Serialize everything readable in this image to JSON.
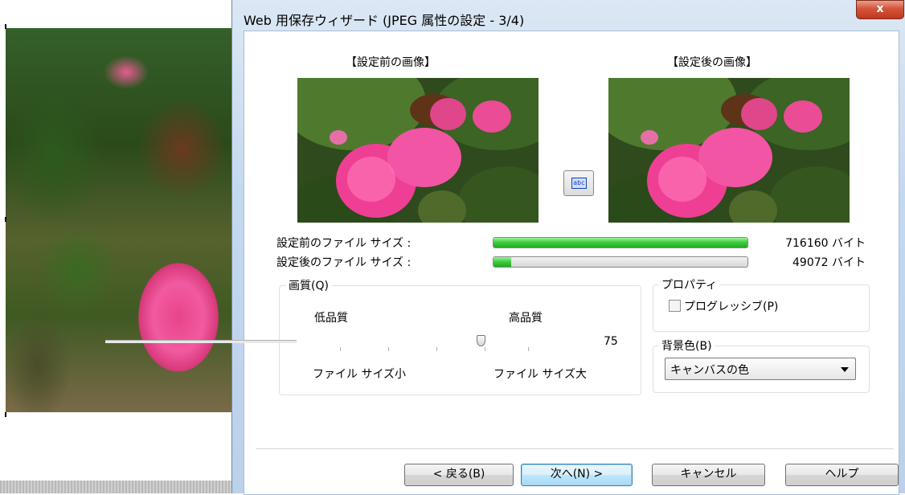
{
  "window": {
    "title": "Web 用保存ウィザード (JPEG 属性の設定 - 3/4)",
    "close_glyph": "x"
  },
  "previews": {
    "before_caption": "【設定前の画像】",
    "after_caption": "【設定後の画像】",
    "swap_glyph": "abc"
  },
  "file_sizes": {
    "before_label": "設定前のファイル サイズ :",
    "before_value": "716160 バイト",
    "before_fraction": 1.0,
    "after_label": "設定後のファイル サイズ :",
    "after_value": "49072 バイト",
    "after_fraction": 0.0685
  },
  "quality": {
    "group_title": "画質(Q)",
    "low_label": "低品質",
    "high_label": "高品質",
    "value": "75",
    "min": 0,
    "max": 100,
    "small_label": "ファイル サイズ小",
    "large_label": "ファイル サイズ大"
  },
  "properties": {
    "group_title": "プロパティ",
    "progressive_label": "プログレッシブ(P)",
    "progressive_checked": false
  },
  "background": {
    "group_title": "背景色(B)",
    "selected": "キャンバスの色"
  },
  "buttons": {
    "back": "< 戻る(B)",
    "next": "次へ(N) >",
    "cancel": "キャンセル",
    "help": "ヘルプ"
  },
  "colors": {
    "progress_fill": "#3fcf3f",
    "default_button": "#3c7fb1",
    "close_button": "#c0391f"
  }
}
